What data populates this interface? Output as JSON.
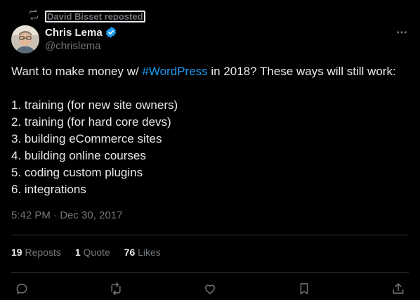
{
  "repost": {
    "text": "David Bisset reposted",
    "icon": "repost-icon"
  },
  "author": {
    "name": "Chris Lema",
    "handle": "@chrislema",
    "verified": true,
    "verified_icon": "verified-badge-icon"
  },
  "tweet": {
    "line1_prefix": "Want to make money w/ ",
    "hashtag": "#WordPress",
    "line1_suffix": " in 2018? These ways will still work:",
    "items": [
      "1. training (for new site owners)",
      "2. training (for hard core devs)",
      "3. building eCommerce sites",
      "4. building online courses",
      "5. coding custom plugins",
      "6. integrations"
    ]
  },
  "meta": {
    "timestamp": "5:42 PM · Dec 30, 2017"
  },
  "stats": {
    "reposts_count": "19",
    "reposts_label": "Reposts",
    "quotes_count": "1",
    "quotes_label": "Quote",
    "likes_count": "76",
    "likes_label": "Likes"
  },
  "actions": [
    "reply-icon",
    "repost-icon",
    "like-icon",
    "bookmark-icon",
    "share-icon"
  ],
  "colors": {
    "background": "#000000",
    "text": "#e7e9ea",
    "muted": "#71767b",
    "link": "#1d9bf0",
    "divider": "#2f3336"
  }
}
